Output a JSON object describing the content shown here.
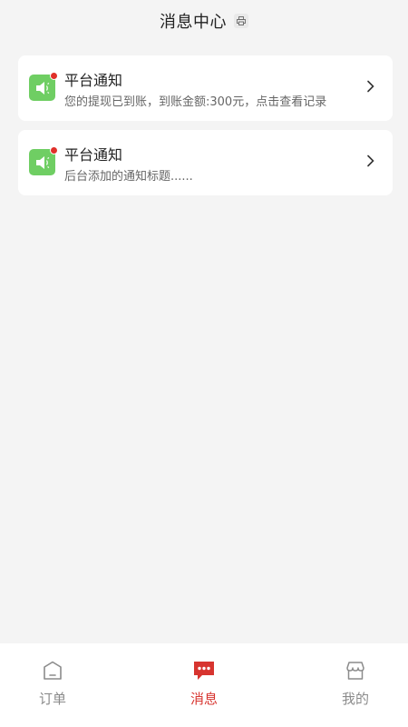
{
  "header": {
    "title": "消息中心",
    "badge_icon": "printer-icon"
  },
  "messages": [
    {
      "icon": "speaker-icon",
      "title": "平台通知",
      "subtitle": "您的提现已到账，到账金额:300元，点击查看记录",
      "unread": true
    },
    {
      "icon": "speaker-icon",
      "title": "平台通知",
      "subtitle": "后台添加的通知标题......",
      "unread": true
    }
  ],
  "tabbar": {
    "tabs": [
      {
        "label": "订单",
        "icon": "order-icon",
        "active": false
      },
      {
        "label": "消息",
        "icon": "message-icon",
        "active": true
      },
      {
        "label": "我的",
        "icon": "store-icon",
        "active": false
      }
    ],
    "active_color": "#d7342f",
    "inactive_color": "#8b8b8b"
  },
  "colors": {
    "background": "#f4f4f4",
    "icon_green": "#6fce63",
    "unread_dot": "#e0302a"
  }
}
